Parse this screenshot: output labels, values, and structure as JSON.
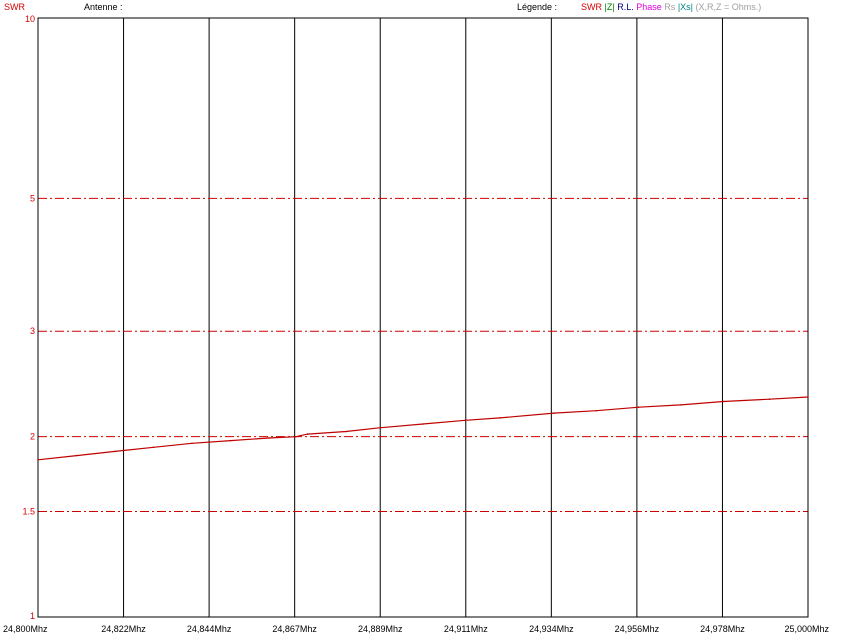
{
  "header": {
    "y_title": "SWR",
    "antenna_label": "Antenne :",
    "legend_label": "Légende :",
    "legend_items": [
      {
        "name": "SWR",
        "text": "SWR",
        "color": "#d40000"
      },
      {
        "name": "z",
        "text": "|Z|",
        "color": "#008000"
      },
      {
        "name": "rl",
        "text": "R.L.",
        "color": "#000080"
      },
      {
        "name": "phase",
        "text": "Phase",
        "color": "#e000e0"
      },
      {
        "name": "rs",
        "text": "Rs",
        "color": "#a0a0a0"
      },
      {
        "name": "xs",
        "text": "|Xs|",
        "color": "#008080"
      },
      {
        "name": "units",
        "text": "(X,R,Z = Ohms.)",
        "color": "#a0a0a0"
      }
    ]
  },
  "chart_data": {
    "type": "line",
    "title": "",
    "xlabel": "",
    "ylabel": "SWR",
    "y_scale": "log",
    "ylim": [
      1,
      10
    ],
    "xlim": [
      24.8,
      25.0
    ],
    "x_tick_labels": [
      "24,800Mhz",
      "24,822Mhz",
      "24,844Mhz",
      "24,867Mhz",
      "24,889Mhz",
      "24,911Mhz",
      "24,934Mhz",
      "24,956Mhz",
      "24,978Mhz",
      "25,000Mhz"
    ],
    "y_ticks": [
      {
        "value": 10,
        "label": "10"
      },
      {
        "value": 5,
        "label": "5"
      },
      {
        "value": 3,
        "label": "3"
      },
      {
        "value": 2,
        "label": "2"
      },
      {
        "value": 1.5,
        "label": "1.5"
      },
      {
        "value": 1,
        "label": "1"
      }
    ],
    "grid": {
      "vertical": "solid",
      "horizontal": "dash-dot",
      "horizontal_values": [
        5,
        3,
        2,
        1.5
      ]
    },
    "series": [
      {
        "name": "SWR",
        "color": "#c00000",
        "x": [
          24.8,
          24.81,
          24.82,
          24.83,
          24.84,
          24.85,
          24.86,
          24.867,
          24.87,
          24.88,
          24.889,
          24.9,
          24.911,
          24.92,
          24.934,
          24.945,
          24.956,
          24.967,
          24.978,
          24.99,
          25.0
        ],
        "y": [
          1.83,
          1.86,
          1.89,
          1.92,
          1.95,
          1.97,
          1.99,
          2.0,
          2.02,
          2.04,
          2.07,
          2.1,
          2.13,
          2.15,
          2.19,
          2.21,
          2.24,
          2.26,
          2.29,
          2.31,
          2.33
        ]
      }
    ]
  }
}
